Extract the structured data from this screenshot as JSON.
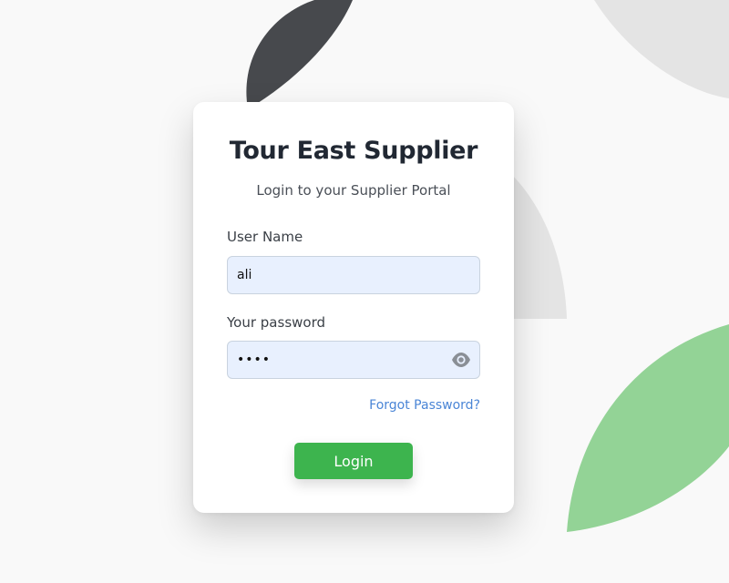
{
  "card": {
    "title": "Tour East Supplier",
    "subtitle": "Login to your Supplier Portal"
  },
  "form": {
    "username_label": "User Name",
    "username_value": "ali",
    "password_label": "Your password",
    "password_value": "abcd",
    "password_toggle_icon": "eye-icon",
    "forgot_label": "Forgot Password?",
    "login_label": "Login"
  },
  "colors": {
    "accent_green": "#3db44e",
    "link_blue": "#4a85d6",
    "input_fill": "#e8f0fe",
    "shape_dark": "#47494d",
    "shape_light_gray": "#e4e4e4",
    "shape_light_green": "#93d396"
  }
}
